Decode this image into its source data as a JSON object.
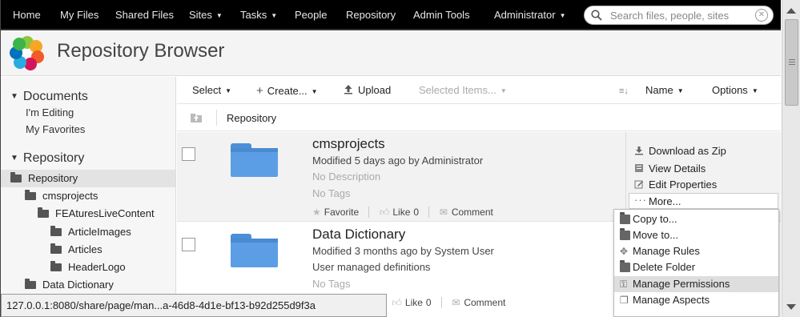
{
  "nav": {
    "items": [
      {
        "label": "Home",
        "dropdown": false
      },
      {
        "label": "My Files",
        "dropdown": false
      },
      {
        "label": "Shared Files",
        "dropdown": false
      },
      {
        "label": "Sites",
        "dropdown": true
      },
      {
        "label": "Tasks",
        "dropdown": true
      },
      {
        "label": "People",
        "dropdown": false
      },
      {
        "label": "Repository",
        "dropdown": false
      },
      {
        "label": "Admin Tools",
        "dropdown": false
      },
      {
        "label": "Administrator",
        "dropdown": true
      }
    ],
    "search_placeholder": "Search files, people, sites",
    "search_icon": "search-icon",
    "clear_icon": "clear-icon"
  },
  "header": {
    "title": "Repository Browser",
    "logo_icon": "alfresco-flower-icon"
  },
  "sidebar": {
    "documents_heading": "Documents",
    "documents_links": [
      "I'm Editing",
      "My Favorites"
    ],
    "repository_heading": "Repository",
    "tree": [
      {
        "label": "Repository",
        "level": 0,
        "selected": true
      },
      {
        "label": "cmsprojects",
        "level": 1,
        "selected": false
      },
      {
        "label": "FEAturesLiveContent",
        "level": 2,
        "selected": false
      },
      {
        "label": "ArticleImages",
        "level": 3,
        "selected": false
      },
      {
        "label": "Articles",
        "level": 3,
        "selected": false
      },
      {
        "label": "HeaderLogo",
        "level": 3,
        "selected": false
      },
      {
        "label": "Data Dictionary",
        "level": 1,
        "selected": false
      }
    ]
  },
  "toolbar": {
    "select_label": "Select",
    "create_label": "Create...",
    "upload_label": "Upload",
    "selected_items_label": "Selected Items...",
    "sort_label": "Name",
    "options_label": "Options"
  },
  "breadcrumb": {
    "label": "Repository"
  },
  "items": [
    {
      "name": "cmsprojects",
      "modified": "Modified 5 days ago by Administrator",
      "description": "No Description",
      "tags": "No Tags",
      "favorite_label": "Favorite",
      "like_label": "Like",
      "like_count": "0",
      "comment_label": "Comment"
    },
    {
      "name": "Data Dictionary",
      "modified": "Modified 3 months ago by System User",
      "description": "User managed definitions",
      "tags": "No Tags",
      "like_label": "Like",
      "like_count": "0",
      "comment_label": "Comment"
    }
  ],
  "row_actions": {
    "download_zip": "Download as Zip",
    "view_details": "View Details",
    "edit_properties": "Edit Properties",
    "more": "More..."
  },
  "more_menu": [
    {
      "label": "Copy to...",
      "highlighted": false
    },
    {
      "label": "Move to...",
      "highlighted": false
    },
    {
      "label": "Manage Rules",
      "highlighted": false
    },
    {
      "label": "Delete Folder",
      "highlighted": false
    },
    {
      "label": "Manage Permissions",
      "highlighted": true
    },
    {
      "label": "Manage Aspects",
      "highlighted": false
    }
  ],
  "status_url": "127.0.0.1:8080/share/page/man...a-46d8-4d1e-bf13-b92d255d9f3a",
  "colors": {
    "nav_bg": "#000000",
    "folder_blue": "#5b9ee5",
    "selected_bg": "#e3e3e3"
  }
}
